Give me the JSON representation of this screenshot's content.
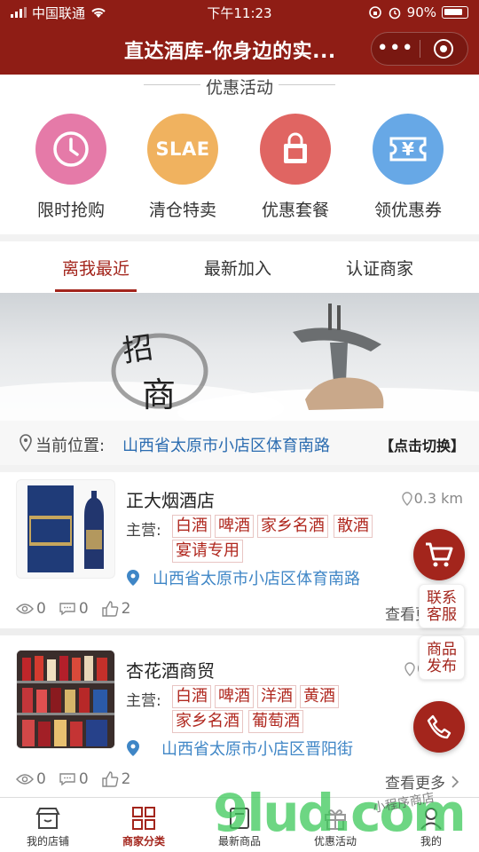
{
  "status_bar": {
    "carrier": "中国联通",
    "time": "下午11:23",
    "battery": "90%"
  },
  "header": {
    "title": "直达酒库-你身边的实..."
  },
  "promo": {
    "title": "优惠活动",
    "items": [
      {
        "label": "限时抢购",
        "color": "#e57aa8",
        "icon": "clock-icon"
      },
      {
        "label": "清仓特卖",
        "color": "#f0b25f",
        "icon": "slae-badge-icon",
        "badge_text": "SLAE"
      },
      {
        "label": "优惠套餐",
        "color": "#e06562",
        "icon": "shopping-bag-icon"
      },
      {
        "label": "领优惠券",
        "color": "#67a8e6",
        "icon": "coupon-icon",
        "badge_text": "¥"
      }
    ]
  },
  "tabs": [
    "离我最近",
    "最新加入",
    "认证商家"
  ],
  "location": {
    "label": "当前位置:",
    "address": "山西省太原市小店区体育南路",
    "switch": "【点击切换】"
  },
  "stores": [
    {
      "name": "正大烟酒店",
      "distance": "0.3 km",
      "main_label": "主营:",
      "tags": [
        "白酒",
        "啤酒",
        "家乡名酒",
        "散酒",
        "宴请专用"
      ],
      "address": "山西省太原市小店区体育南路",
      "views": "0",
      "comments": "0",
      "likes": "2",
      "more": "查看更多"
    },
    {
      "name": "杏花酒商贸",
      "distance": "0",
      "main_label": "主营:",
      "tags": [
        "白酒",
        "啤酒",
        "洋酒",
        "黄酒",
        "家乡名酒",
        "葡萄酒"
      ],
      "address": "山西省太原市小店区晋阳街",
      "views": "0",
      "comments": "0",
      "likes": "2",
      "more": "查看更多"
    }
  ],
  "floating": {
    "contact": "联系客服",
    "publish": "商品发布"
  },
  "banner": {
    "calligraphy_1": "招",
    "calligraphy_2": "商"
  },
  "tabbar": [
    {
      "label": "我的店铺"
    },
    {
      "label": "商家分类"
    },
    {
      "label": "最新商品"
    },
    {
      "label": "优惠活动"
    },
    {
      "label": "我的"
    }
  ],
  "watermark": {
    "text": "9lud.com",
    "small_text": "小程序商店"
  },
  "colors": {
    "brand": "#8f1d15",
    "accent": "#a3251c",
    "link": "#3f86c6"
  }
}
